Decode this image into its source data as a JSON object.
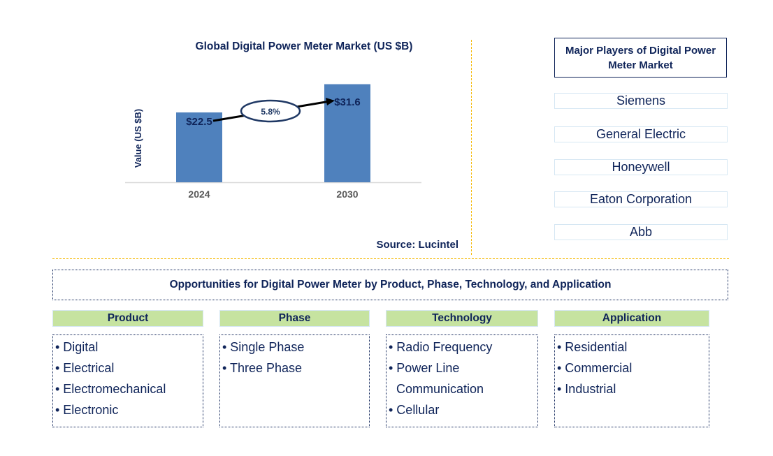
{
  "chart_data": {
    "type": "bar",
    "title": "Global Digital Power Meter Market (US $B)",
    "xlabel": "",
    "ylabel": "Value (US $B)",
    "categories": [
      "2024",
      "2030"
    ],
    "values": [
      22.5,
      31.6
    ],
    "data_labels": [
      "$22.5",
      "$31.6"
    ],
    "ylim": [
      0,
      45
    ],
    "grid": false,
    "legend": "none",
    "annotation": {
      "text": "5.8%",
      "type": "CAGR arrow from 2024 to 2030"
    },
    "bar_color": "#4f81bd"
  },
  "source": "Source: Lucintel",
  "players": {
    "header": "Major Players of Digital Power Meter Market",
    "items": [
      "Siemens",
      "General Electric",
      "Honeywell",
      "Eaton Corporation",
      "Abb"
    ]
  },
  "opportunities": {
    "title": "Opportunities for Digital Power Meter by Product, Phase, Technology, and Application",
    "categories": [
      {
        "name": "Product",
        "items": [
          "Digital",
          "Electrical",
          "Electromechanical",
          "Electronic"
        ]
      },
      {
        "name": "Phase",
        "items": [
          "Single Phase",
          "Three Phase"
        ]
      },
      {
        "name": "Technology",
        "items": [
          "Radio Frequency",
          "Power Line Communication",
          "Cellular"
        ]
      },
      {
        "name": "Application",
        "items": [
          "Residential",
          "Commercial",
          "Industrial"
        ]
      }
    ]
  },
  "colors": {
    "text_navy": "#0f2459",
    "bar_blue": "#4f81bd",
    "category_green": "#c6e3a0",
    "divider_gold": "#f5b800",
    "player_border": "#d6e7f3"
  }
}
